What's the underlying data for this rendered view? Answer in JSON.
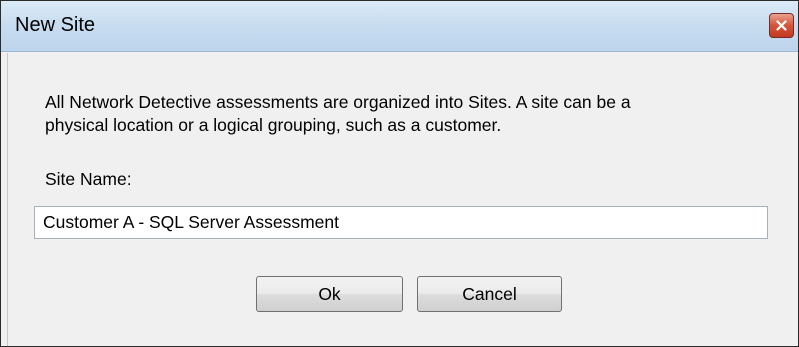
{
  "window": {
    "title": "New Site"
  },
  "dialog": {
    "description_line1": "All Network Detective assessments are organized into Sites. A site can be a",
    "description_line2": "physical location or a logical grouping, such as a customer.",
    "site_name_label": "Site Name:",
    "site_name_value": "Customer A - SQL Server Assessment"
  },
  "buttons": {
    "ok_label": "Ok",
    "cancel_label": "Cancel"
  },
  "icons": {
    "close": "close-icon"
  },
  "colors": {
    "titlebar": "#c9ddf0",
    "close_button": "#d2543a",
    "client_background": "#f0f0f0"
  }
}
